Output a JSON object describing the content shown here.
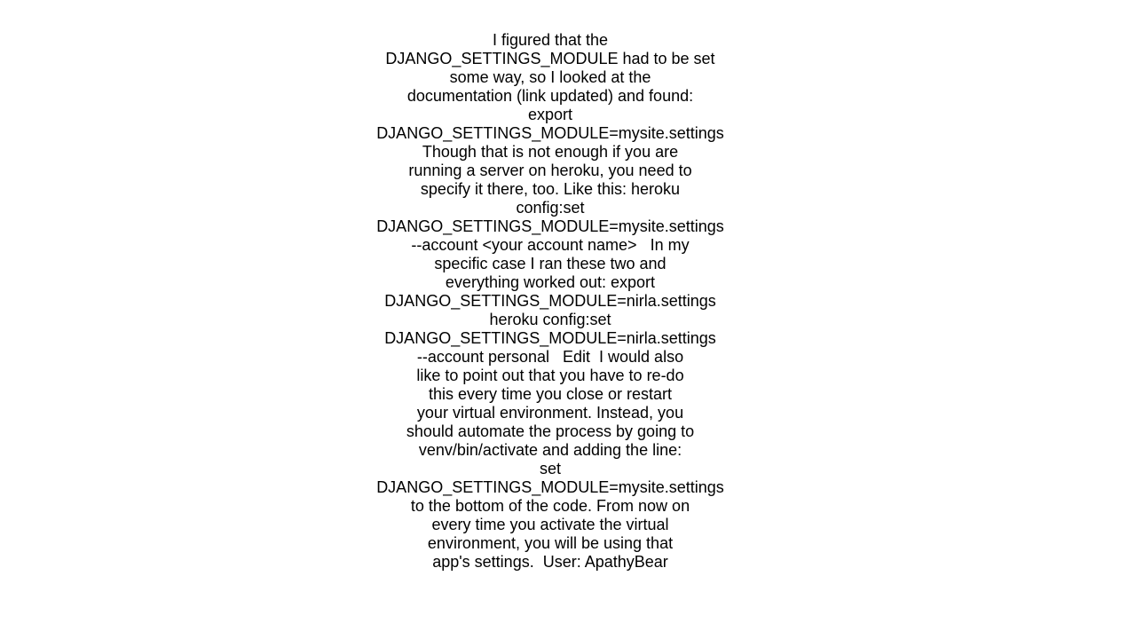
{
  "document": {
    "lines": [
      "I figured that the",
      "DJANGO_SETTINGS_MODULE had to be set",
      "some way, so I looked at the",
      "documentation (link updated) and found:",
      "export",
      "DJANGO_SETTINGS_MODULE=mysite.settings",
      "Though that is not enough if you are",
      "running a server on heroku, you need to",
      "specify it there, too. Like this: heroku",
      "config:set",
      "DJANGO_SETTINGS_MODULE=mysite.settings",
      "--account <your account name>   In my",
      "specific case I ran these two and",
      "everything worked out: export",
      "DJANGO_SETTINGS_MODULE=nirla.settings",
      "heroku config:set",
      "DJANGO_SETTINGS_MODULE=nirla.settings",
      "--account personal   Edit  I would also",
      "like to point out that you have to re-do",
      "this every time you close or restart",
      "your virtual environment. Instead, you",
      "should automate the process by going to",
      "venv/bin/activate and adding the line:",
      "set",
      "DJANGO_SETTINGS_MODULE=mysite.settings",
      "to the bottom of the code. From now on",
      "every time you activate the virtual",
      "environment, you will be using that",
      "app's settings.  User: ApathyBear"
    ]
  }
}
